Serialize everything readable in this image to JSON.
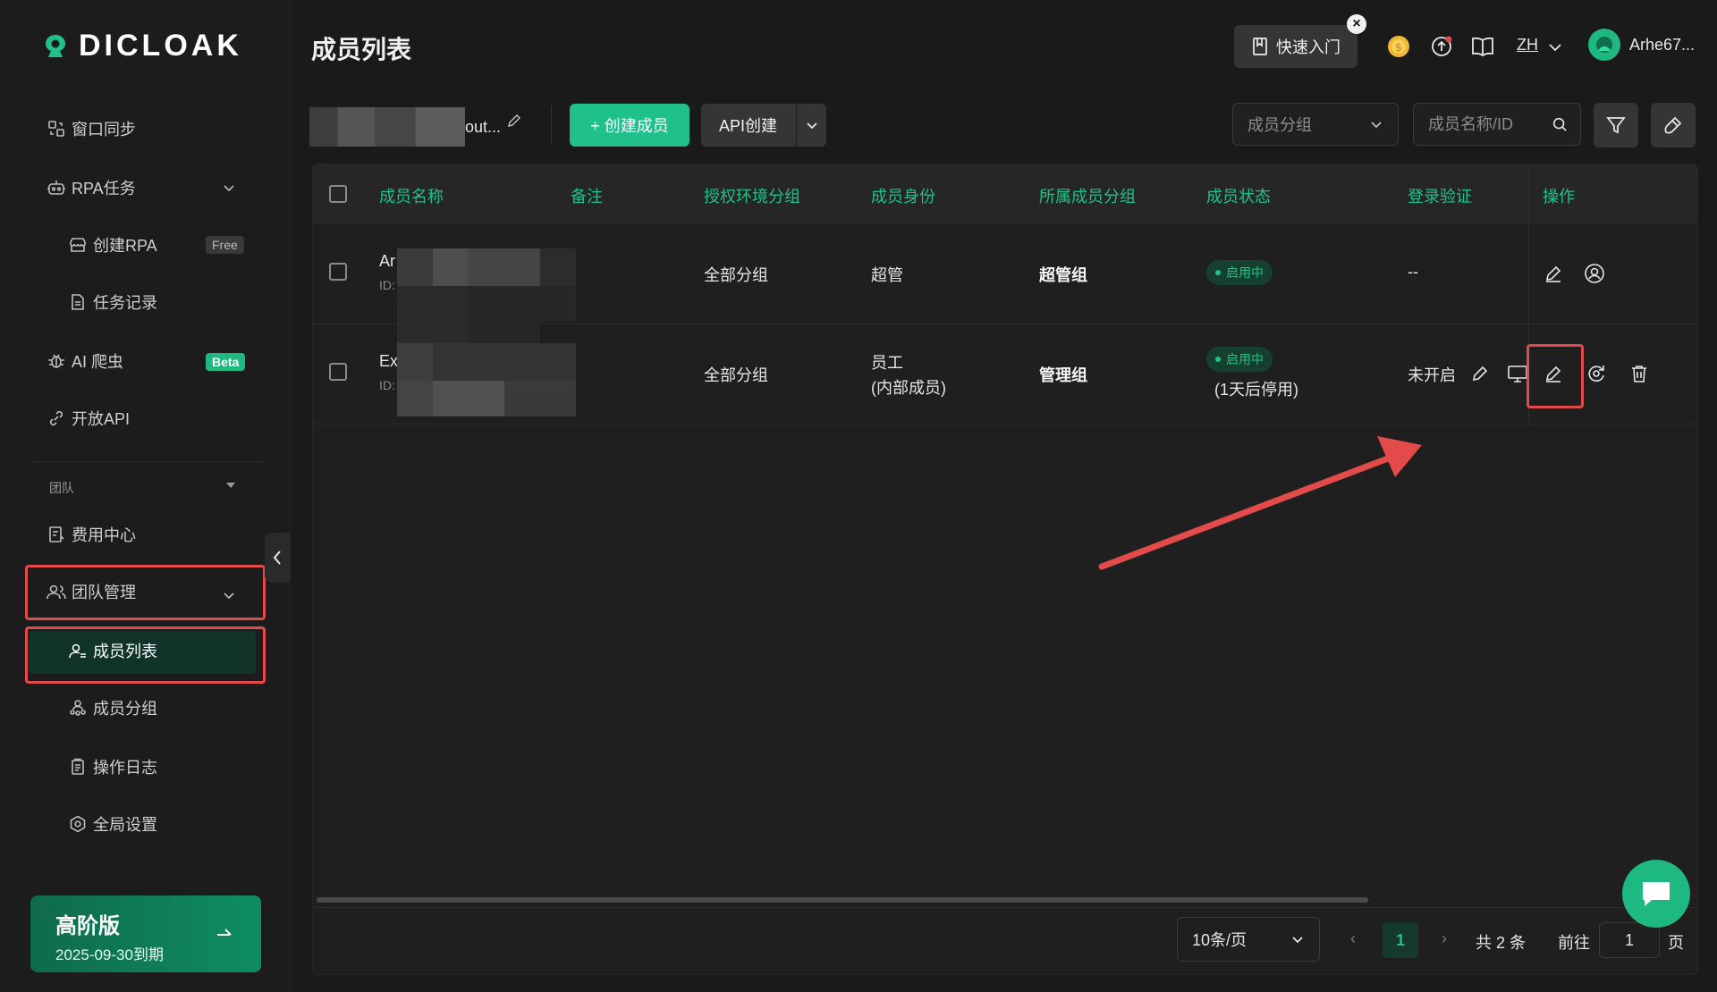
{
  "brand": {
    "name": "DICLOAK"
  },
  "sidebar": {
    "items": [
      {
        "label": "窗口同步",
        "icon": "window-sync-icon"
      },
      {
        "label": "RPA任务",
        "icon": "robot-icon"
      },
      {
        "label": "创建RPA",
        "icon": "store-icon",
        "badge": "Free"
      },
      {
        "label": "任务记录",
        "icon": "document-icon"
      },
      {
        "label": "AI 爬虫",
        "icon": "bug-icon",
        "badge": "Beta"
      },
      {
        "label": "开放API",
        "icon": "api-link-icon"
      }
    ],
    "section_label": "团队",
    "team_items": [
      {
        "label": "费用中心",
        "icon": "billing-icon"
      },
      {
        "label": "团队管理",
        "icon": "team-icon"
      },
      {
        "label": "成员列表",
        "icon": "member-list-icon",
        "active": true
      },
      {
        "label": "成员分组",
        "icon": "member-group-icon"
      },
      {
        "label": "操作日志",
        "icon": "clipboard-icon"
      },
      {
        "label": "全局设置",
        "icon": "settings-hex-icon"
      }
    ],
    "plan": {
      "title": "高阶版",
      "expiry": "2025-09-30到期"
    }
  },
  "header": {
    "title": "成员列表",
    "quick_start": "快速入门",
    "language": "ZH",
    "username": "Arhe67..."
  },
  "toolbar": {
    "team_name_suffix": "out...",
    "create_member": "+ 创建成员",
    "api_create": "API创建",
    "group_select_placeholder": "成员分组",
    "search_placeholder": "成员名称/ID"
  },
  "table": {
    "columns": [
      "成员名称",
      "备注",
      "授权环境分组",
      "成员身份",
      "所属成员分组",
      "成员状态",
      "登录验证",
      "操作"
    ],
    "rows": [
      {
        "name_prefix": "Ar",
        "id_prefix": "ID:",
        "env_group": "全部分组",
        "role": "超管",
        "role_sub": "",
        "member_group": "超管组",
        "status": "启用中",
        "status_note": "",
        "login_verify": "--"
      },
      {
        "name_prefix": "Ex",
        "id_prefix": "ID:",
        "env_group": "全部分组",
        "role": "员工",
        "role_sub": "(内部成员)",
        "member_group": "管理组",
        "status": "启用中",
        "status_note": "(1天后停用)",
        "login_verify": "未开启"
      }
    ]
  },
  "pagination": {
    "page_size": "10条/页",
    "current_page": "1",
    "total": "共 2 条",
    "goto_label": "前往",
    "goto_value": "1",
    "page_unit": "页"
  },
  "colors": {
    "accent": "#1fc08a",
    "highlight": "#e34a4a",
    "background": "#1a1a1a"
  }
}
